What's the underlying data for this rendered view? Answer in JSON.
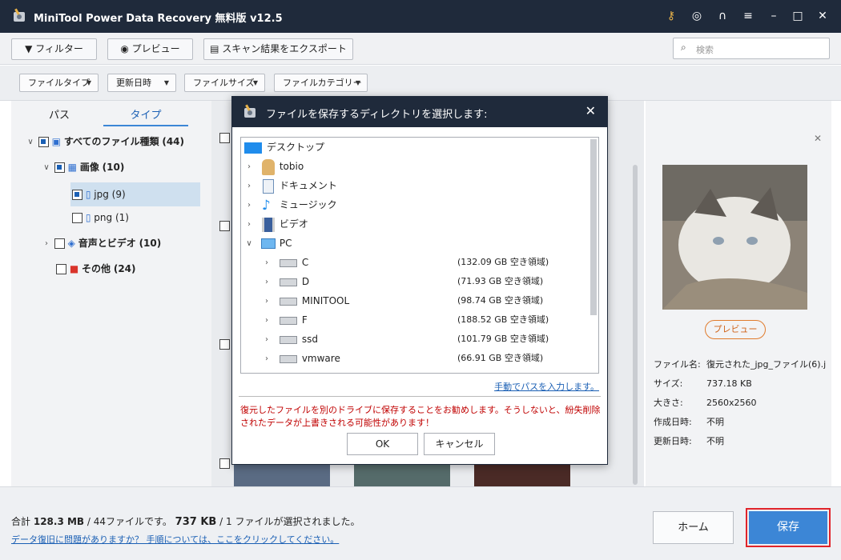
{
  "app": {
    "title": "MiniTool Power Data Recovery 無料版 v12.5"
  },
  "toolbar": {
    "filter_label": "フィルター",
    "preview_label": "プレビュー",
    "export_label": "スキャン結果をエクスポート",
    "search_placeholder": "検索"
  },
  "filters": {
    "file_type": "ファイルタイプ",
    "modified": "更新日時",
    "file_size": "ファイルサイズ",
    "category": "ファイルカテゴリー"
  },
  "tree": {
    "tabs": [
      "パス",
      "タイプ"
    ],
    "items": [
      {
        "label": "すべてのファイル種類",
        "count": "(44)"
      },
      {
        "label": "画像",
        "count": "(10)"
      },
      {
        "label": "jpg",
        "count": "(9)"
      },
      {
        "label": "png",
        "count": "(1)"
      },
      {
        "label": "音声とビデオ",
        "count": "(10)"
      },
      {
        "label": "その他",
        "count": "(24)"
      }
    ]
  },
  "preview": {
    "button_label": "プレビュー",
    "fields": [
      {
        "key": "ファイル名:",
        "value": "復元された_jpg_ファイル(6).j"
      },
      {
        "key": "サイズ:",
        "value": "737.18 KB"
      },
      {
        "key": "大きさ:",
        "value": "2560x2560"
      },
      {
        "key": "作成日時:",
        "value": "不明"
      },
      {
        "key": "更新日時:",
        "value": "不明"
      }
    ]
  },
  "status": {
    "total_prefix": "合計",
    "total_size": "128.3 MB",
    "files_text": "/ 44ファイルです。",
    "selected_size": "737 KB",
    "selected_text": "/ 1 ファイルが選択されました。",
    "help_link": "データ復旧に問題がありますか？ 手順については、ここをクリックしてください。",
    "home_label": "ホーム",
    "save_label": "保存"
  },
  "dialog": {
    "title": "ファイルを保存するディレクトリを選択します:",
    "rows": [
      {
        "label": "デスクトップ"
      },
      {
        "label": "tobio"
      },
      {
        "label": "ドキュメント"
      },
      {
        "label": "ミュージック"
      },
      {
        "label": "ビデオ"
      },
      {
        "label": "PC"
      }
    ],
    "drives": [
      {
        "label": "C",
        "space": "(132.09 GB 空き領域)"
      },
      {
        "label": "D",
        "space": "(71.93 GB 空き領域)"
      },
      {
        "label": "MINITOOL",
        "space": "(98.74 GB 空き領域)"
      },
      {
        "label": "F",
        "space": "(188.52 GB 空き領域)"
      },
      {
        "label": "ssd",
        "space": "(101.79 GB 空き領域)"
      },
      {
        "label": "vmware",
        "space": "(66.91 GB 空き領域)"
      }
    ],
    "manual_path_link": "手動でパスを入力します。",
    "warning": "復元したファイルを別のドライブに保存することをお勧めします。そうしないと、紛失削除されたデータが上書きされる可能性があります！",
    "ok_label": "OK",
    "cancel_label": "キャンセル"
  },
  "colors": {
    "titlebar": "#1f2a3b",
    "accent": "#3c86d6",
    "warning": "#c00000",
    "link": "#1a5fb4",
    "preview_outline": "#e07b2c"
  }
}
